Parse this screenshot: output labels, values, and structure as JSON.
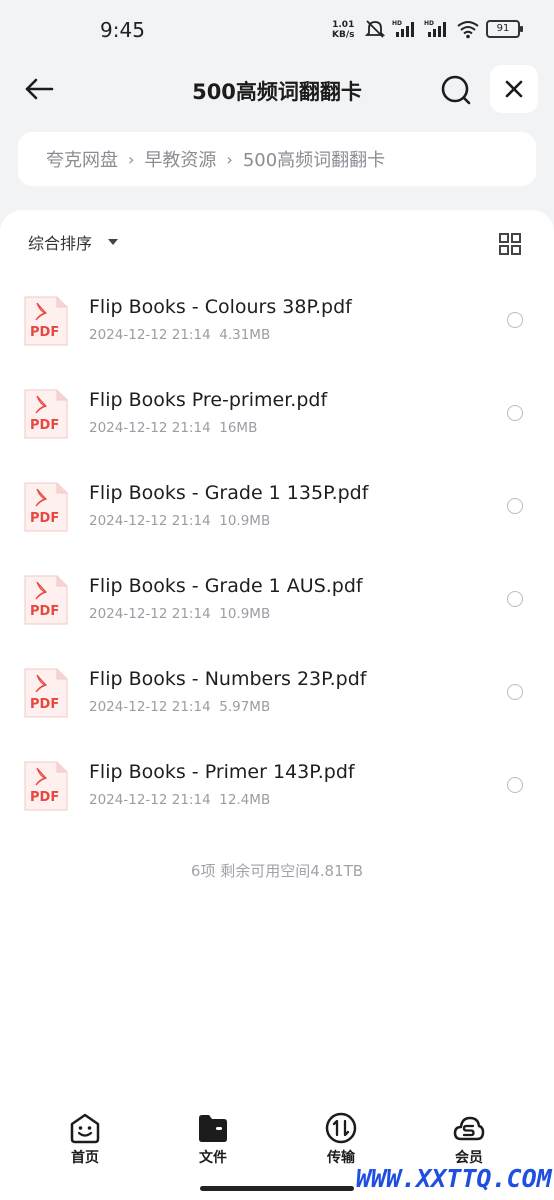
{
  "status": {
    "time": "9:45",
    "speed_value": "1.01",
    "speed_unit": "KB/s",
    "battery": "91"
  },
  "nav": {
    "title": "500高频词翻翻卡"
  },
  "breadcrumb": {
    "items": [
      "夸克网盘",
      "早教资源",
      "500高频词翻翻卡"
    ]
  },
  "toolbar": {
    "sort_label": "综合排序"
  },
  "files": [
    {
      "name": "Flip Books - Colours 38P.pdf",
      "date": "2024-12-12 21:14",
      "size": "4.31MB",
      "icon": "pdf-icon"
    },
    {
      "name": "Flip Books Pre-primer.pdf",
      "date": "2024-12-12 21:14",
      "size": "16MB",
      "icon": "pdf-icon"
    },
    {
      "name": "Flip Books - Grade 1 135P.pdf",
      "date": "2024-12-12 21:14",
      "size": "10.9MB",
      "icon": "pdf-icon"
    },
    {
      "name": "Flip Books - Grade 1 AUS.pdf",
      "date": "2024-12-12 21:14",
      "size": "10.9MB",
      "icon": "pdf-icon"
    },
    {
      "name": "Flip Books - Numbers 23P.pdf",
      "date": "2024-12-12 21:14",
      "size": "5.97MB",
      "icon": "pdf-icon"
    },
    {
      "name": "Flip Books - Primer 143P.pdf",
      "date": "2024-12-12 21:14",
      "size": "12.4MB",
      "icon": "pdf-icon"
    }
  ],
  "pdf_icon_label": "PDF",
  "summary": "6项 剩余可用空间4.81TB",
  "tabs": [
    {
      "label": "首页",
      "icon": "home-face-icon"
    },
    {
      "label": "文件",
      "icon": "folder-icon"
    },
    {
      "label": "传输",
      "icon": "transfer-icon"
    },
    {
      "label": "会员",
      "icon": "vip-cloud-icon"
    }
  ],
  "watermark": "WWW.XXTTQ.COM",
  "colors": {
    "accent": "#1f4fe0",
    "pdf_red": "#e8473f",
    "background": "#f2f3f5"
  }
}
